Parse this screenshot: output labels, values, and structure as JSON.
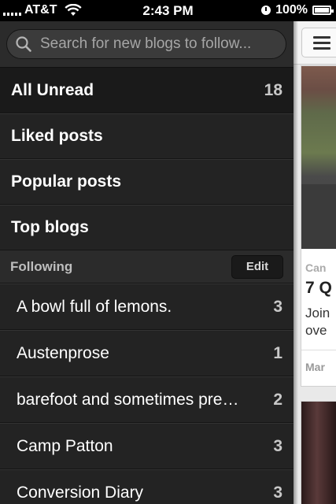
{
  "status_bar": {
    "carrier": "AT&T",
    "time": "2:43 PM",
    "battery": "100%",
    "signal_icon": "signal-bars-icon",
    "wifi_icon": "wifi-icon",
    "clock_icon": "alarm-clock-icon",
    "battery_icon": "battery-icon"
  },
  "sidebar": {
    "search": {
      "placeholder": "Search for new blogs to follow...",
      "icon": "search-icon"
    },
    "nav": [
      {
        "label": "All Unread",
        "count": "18"
      },
      {
        "label": "Liked posts"
      },
      {
        "label": "Popular posts"
      },
      {
        "label": "Top blogs"
      }
    ],
    "following": {
      "title": "Following",
      "edit_label": "Edit",
      "items": [
        {
          "label": "A bowl full of lemons.",
          "count": "3"
        },
        {
          "label": "Austenprose",
          "count": "1"
        },
        {
          "label": "barefoot and sometimes pre…",
          "count": "2"
        },
        {
          "label": "Camp Patton",
          "count": "3"
        },
        {
          "label": "Conversion Diary",
          "count": "3"
        }
      ]
    }
  },
  "content": {
    "menu_icon": "hamburger-menu-icon",
    "card": {
      "source": "Can",
      "title": "7 Q",
      "snippet_line1": "Join",
      "snippet_line2": "ove",
      "meta": "Mar"
    }
  },
  "colors": {
    "sidebar_bg": "#232323",
    "content_bg": "#e9e9e9"
  }
}
